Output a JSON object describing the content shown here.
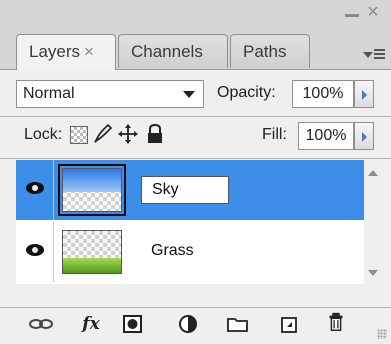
{
  "tabs": [
    {
      "label": "Layers",
      "close": "×",
      "active": true
    },
    {
      "label": "Channels",
      "active": false
    },
    {
      "label": "Paths",
      "active": false
    }
  ],
  "window": {
    "close_glyph": "×"
  },
  "blend_mode": {
    "value": "Normal"
  },
  "opacity": {
    "label": "Opacity:",
    "value": "100%"
  },
  "lock": {
    "label": "Lock:"
  },
  "fill": {
    "label": "Fill:",
    "value": "100%"
  },
  "layers": [
    {
      "name": "Sky",
      "selected": true,
      "visible": true,
      "editing": true
    },
    {
      "name": "Grass",
      "selected": false,
      "visible": true,
      "editing": false
    }
  ],
  "colors": {
    "selection": "#3d8ee8",
    "spin_arrow": "#5578b8"
  },
  "bottom_icons": [
    "link-icon",
    "fx-icon",
    "mask-icon",
    "adjustment-icon",
    "folder-icon",
    "new-layer-icon",
    "trash-icon"
  ],
  "fx_label": "fx"
}
